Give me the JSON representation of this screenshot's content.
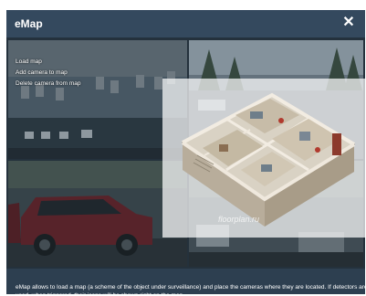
{
  "window": {
    "title": "eMap",
    "close_glyph": "✕"
  },
  "menu": {
    "items": [
      {
        "label": "Load map"
      },
      {
        "label": "Add camera to map"
      },
      {
        "label": "Delete camera from map"
      }
    ]
  },
  "cameras": [
    {
      "view": "parking-lot-aerial"
    },
    {
      "view": "street-with-trees"
    },
    {
      "view": "red-suv-parking"
    },
    {
      "view": "cars-on-street"
    }
  ],
  "overlay": {
    "image": "3d-floor-plan",
    "watermark": "floorplan.ru"
  },
  "footer": {
    "description": "eMap allows to load a map (a scheme of the object under surveillance) and place the cameras where they are located. If detectors are used, when triggered, their icons will be shown right on the map."
  },
  "colors": {
    "window_bg": "#2d3f50",
    "titlebar_bg": "#34495e",
    "text": "#ffffff"
  }
}
